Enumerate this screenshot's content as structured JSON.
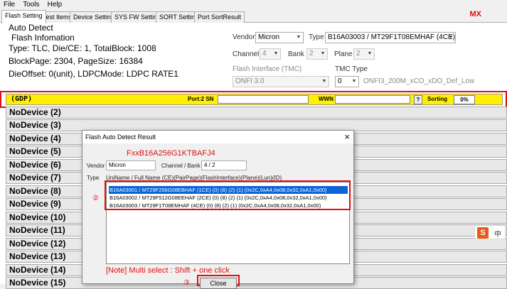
{
  "menu": [
    "File",
    "Tools",
    "Help"
  ],
  "tabs": [
    "Flash Setting",
    "Test Items",
    "Device Setting",
    "SYS FW Setting",
    "SORT Setting",
    "Port SortResult"
  ],
  "brand": "MX",
  "auto_detect": {
    "title": "Auto Detect",
    "info_title": "Flash Infomation",
    "lines": [
      "Type: TLC, Die/CE: 1, TotalBlock: 1008",
      "BlockPage: 2304, PageSize: 16384",
      "DieOffset: 0(unit), LDPCMode: LDPC RATE1"
    ]
  },
  "settings": {
    "vendor_label": "Vendor",
    "vendor_value": "Micron",
    "type_label": "Type",
    "type_value": "B16A03003 / MT29F1T08EMHAF (4CE)",
    "channel_label": "Channel",
    "channel_value": "4",
    "bank_label": "Bank",
    "bank_value": "2",
    "plane_label": "Plane",
    "plane_value": "2",
    "flash_interface_label": "Flash Interface (TMC)",
    "flash_interface_value": "ONFI 3.0",
    "tmc_type_label": "TMC Type",
    "tmc_type_value": "0",
    "tmc_type_desc": "ONFI3_200M_xCO_xDO_Def_Low"
  },
  "gdp_row": {
    "name": "(GDP)",
    "port_label": "Port:2 SN",
    "wwn_label": "WWN",
    "help": "?",
    "sorting_label": "Sorting",
    "percent": "0%"
  },
  "devices": [
    "NoDevice (2)",
    "NoDevice (3)",
    "NoDevice (4)",
    "NoDevice (5)",
    "NoDevice (6)",
    "NoDevice (7)",
    "NoDevice (8)",
    "NoDevice (9)",
    "NoDevice (10)",
    "NoDevice (11)",
    "NoDevice (12)",
    "NoDevice (13)",
    "NoDevice (14)",
    "NoDevice (15)"
  ],
  "dialog": {
    "title": "Flash Auto Detect Result",
    "close_x": "×",
    "model": "FxxB16A256G1KTBAFJ4",
    "vendor_label": "Vendor",
    "vendor_value": "Micron",
    "channel_bank_label": "Channel / Bank",
    "channel_bank_value": "4 / 2",
    "type_label": "Type",
    "columns": "UniName / Full Name (CE)(PairPage)(FlashInterface)(Plane)(Lun)(ID)",
    "items": [
      "B16A03001 / MT29F256G08EBHAF (1CE) (0) (8) (2) (1) (0x2C,0xA4,0x08,0x32,0xA1,0x00)",
      "B16A03002 / MT29F512G08EEHAF (2CE) (0) (8) (2) (1) (0x2C,0xA4,0x08,0x32,0xA1,0x00)",
      "B16A03003 / MT29F1T08EMHAF (4CE) (0) (8) (2) (1) (0x2C,0xA4,0x08,0x32,0xA1,0x00)"
    ],
    "marker_2": "②",
    "marker_3": "③",
    "note": "[Note] Multi select : Shift + one click",
    "close_label": "Close"
  },
  "ime": {
    "logo": "S",
    "lang": "中"
  }
}
